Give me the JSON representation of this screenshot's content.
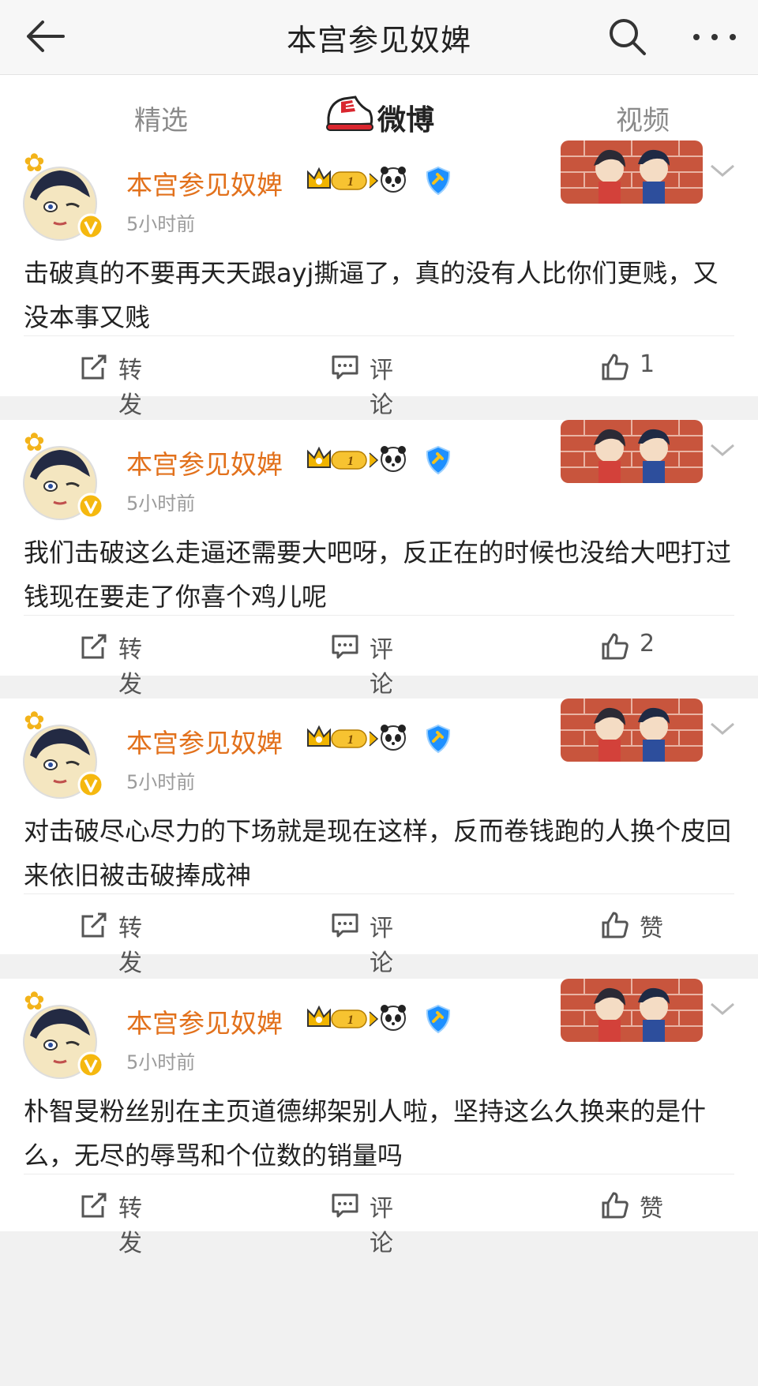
{
  "header": {
    "title": "本宫参见奴婢"
  },
  "tabs": {
    "left": "精选",
    "center": "微博",
    "right": "视频",
    "hearts": "♥♥♥♥♥"
  },
  "posts": [
    {
      "username": "本宫参见奴婢",
      "level": "1",
      "time": "5小时前",
      "text": "击破真的不要再天天跟ayj撕逼了，真的没有人比你们更贱，又没本事又贱",
      "repost": "转发",
      "comment": "评论",
      "like": "1"
    },
    {
      "username": "本宫参见奴婢",
      "level": "1",
      "time": "5小时前",
      "text": "我们击破这么走逼还需要大吧呀，反正在的时候也没给大吧打过钱现在要走了你喜个鸡儿呢",
      "repost": "转发",
      "comment": "评论",
      "like": "2"
    },
    {
      "username": "本宫参见奴婢",
      "level": "1",
      "time": "5小时前",
      "text": "对击破尽心尽力的下场就是现在这样，反而卷钱跑的人换个皮回来依旧被击破捧成神",
      "repost": "转发",
      "comment": "评论",
      "like": "赞"
    },
    {
      "username": "本宫参见奴婢",
      "level": "1",
      "time": "5小时前",
      "text": "朴智旻粉丝别在主页道德绑架别人啦，坚持这么久换来的是什么，无尽的辱骂和个位数的销量吗",
      "repost": "转发",
      "comment": "评论",
      "like": "赞"
    }
  ],
  "colors": {
    "username": "#e2711c",
    "accent_blue": "#1e90ff",
    "crown_gold": "#f0b400"
  }
}
